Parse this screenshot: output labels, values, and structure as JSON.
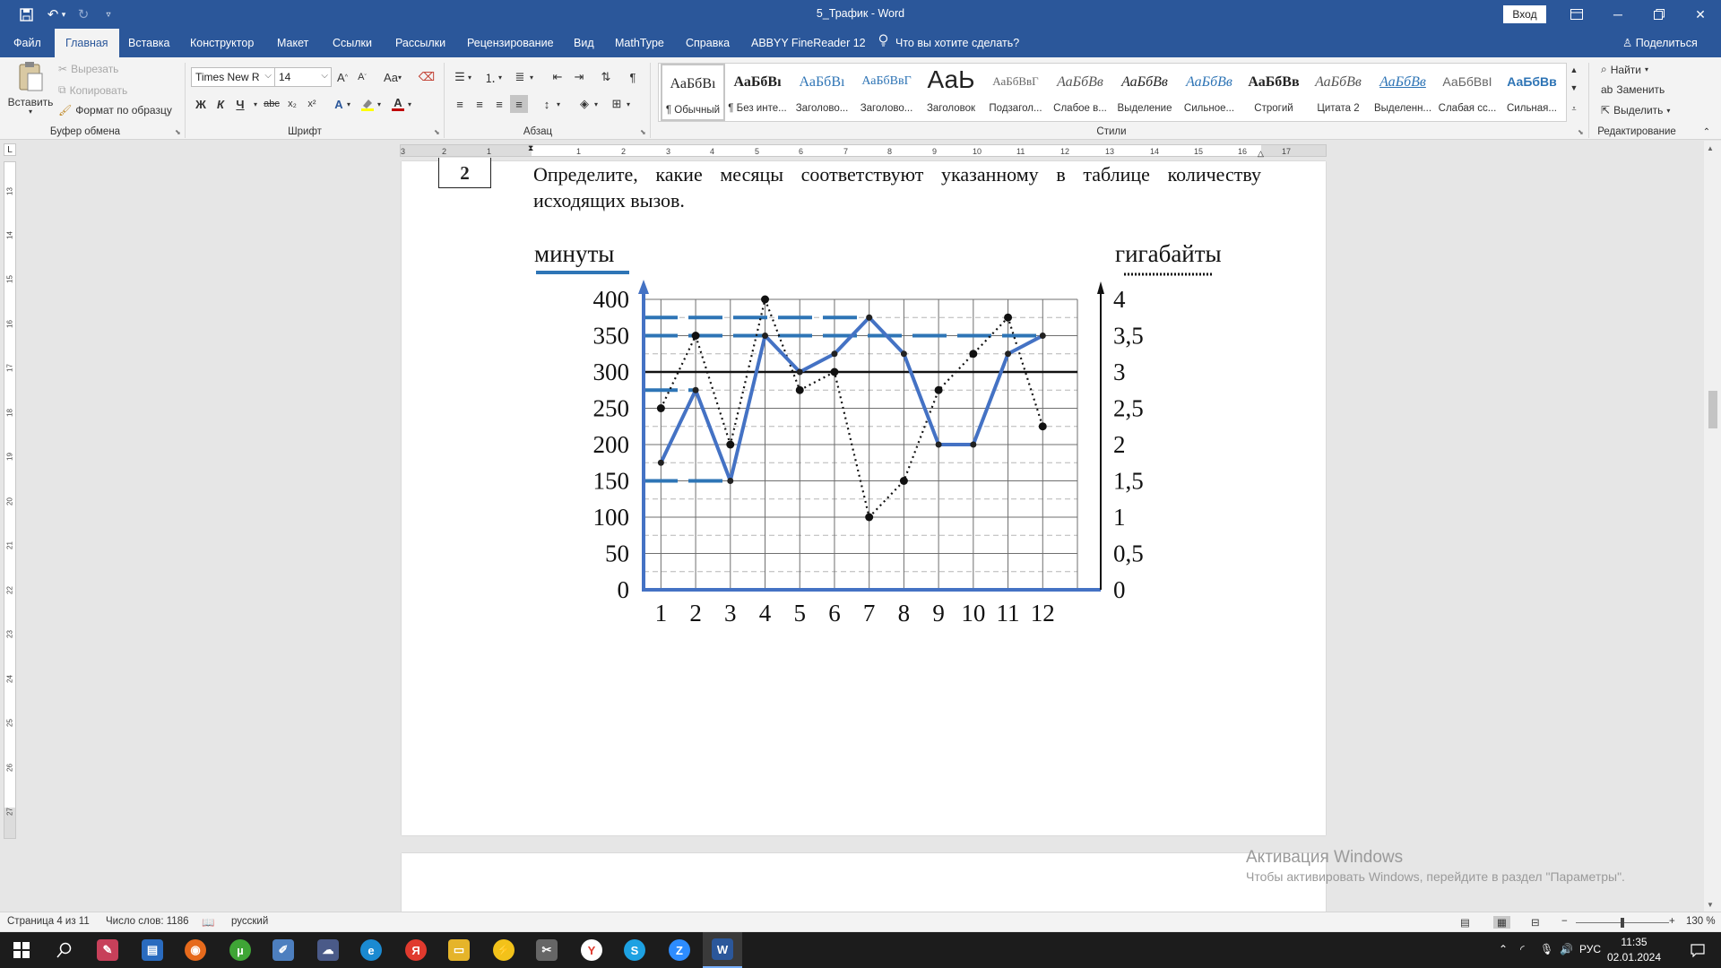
{
  "title_bar": {
    "document_title": "5_Трафик  -  Word",
    "signin_label": "Вход"
  },
  "tabs": [
    "Файл",
    "Главная",
    "Вставка",
    "Конструктор",
    "Макет",
    "Ссылки",
    "Рассылки",
    "Рецензирование",
    "Вид",
    "MathType",
    "Справка",
    "ABBYY FineReader 12"
  ],
  "tell_me": "Что вы хотите сделать?",
  "share_label": "Поделиться",
  "clipboard": {
    "paste": "Вставить",
    "cut": "Вырезать",
    "copy": "Копировать",
    "format_painter": "Формат по образцу",
    "group": "Буфер обмена"
  },
  "font": {
    "name": "Times New R",
    "size": "14",
    "group": "Шрифт",
    "bold": "Ж",
    "italic": "К",
    "underline": "Ч",
    "strike": "abc",
    "sub": "x₂",
    "sup": "x²",
    "case": "Aa",
    "grow": "A",
    "shrink": "A"
  },
  "paragraph": {
    "group": "Абзац"
  },
  "styles": {
    "group": "Стили",
    "items": [
      {
        "preview": "АаБбВı",
        "name": "¶ Обычный"
      },
      {
        "preview": "АаБбВı",
        "name": "¶ Без инте..."
      },
      {
        "preview": "АаБбВı",
        "name": "Заголово..."
      },
      {
        "preview": "АаБбВвГ",
        "name": "Заголово..."
      },
      {
        "preview": "АаЬ",
        "name": "Заголовок"
      },
      {
        "preview": "АаБбВвГ",
        "name": "Подзагол..."
      },
      {
        "preview": "АаБбВв",
        "name": "Слабое в..."
      },
      {
        "preview": "АаБбВв",
        "name": "Выделение"
      },
      {
        "preview": "АаБбВв",
        "name": "Сильное..."
      },
      {
        "preview": "АаБбВв",
        "name": "Строгий"
      },
      {
        "preview": "АаБбВв",
        "name": "Цитата 2"
      },
      {
        "preview": "АаБбВв",
        "name": "Выделенн..."
      },
      {
        "preview": "АаБбВвI",
        "name": "Слабая сс..."
      },
      {
        "preview": "АаБбВв",
        "name": "Сильная..."
      }
    ]
  },
  "editing": {
    "group": "Редактирование",
    "find": "Найти",
    "replace": "Заменить",
    "select": "Выделить"
  },
  "ruler_marks": [
    "3",
    "2",
    "1",
    "1",
    "2",
    "3",
    "4",
    "5",
    "6",
    "7",
    "8",
    "9",
    "10",
    "11",
    "12",
    "13",
    "14",
    "15",
    "16",
    "17"
  ],
  "vruler_marks": [
    "13",
    "14",
    "15",
    "16",
    "17",
    "18",
    "19",
    "20",
    "21",
    "22",
    "23",
    "24",
    "25",
    "26",
    "27"
  ],
  "document": {
    "question_number": "2",
    "question_text": "Определите, какие месяцы соответствуют указанному в таблице количеству исходящих вызов."
  },
  "chart_data": {
    "type": "line",
    "left_axis_title": "минуты",
    "right_axis_title": "гигабайты",
    "categories": [
      "1",
      "2",
      "3",
      "4",
      "5",
      "6",
      "7",
      "8",
      "9",
      "10",
      "11",
      "12"
    ],
    "ylim": [
      0,
      400
    ],
    "y2lim": [
      0,
      4
    ],
    "left_ticks": [
      "0",
      "50",
      "100",
      "150",
      "200",
      "250",
      "300",
      "350",
      "400"
    ],
    "right_ticks": [
      "0",
      "0,5",
      "1",
      "1,5",
      "2",
      "2,5",
      "3",
      "3,5",
      "4"
    ],
    "series": [
      {
        "axis": "left",
        "style": "solid",
        "values": [
          175,
          275,
          150,
          350,
          300,
          325,
          375,
          325,
          200,
          200,
          325,
          350
        ]
      },
      {
        "axis": "right",
        "style": "dotted",
        "values": [
          2.5,
          3.5,
          2,
          4,
          2.75,
          3,
          1,
          1.5,
          2.75,
          3.25,
          3.75,
          2.25
        ]
      }
    ],
    "highlighted_levels_minutes": [
      375,
      350,
      275,
      150
    ],
    "reference_level_minutes": 300,
    "grid": true,
    "colors": {
      "minutes": "#4472c4",
      "highlight": "#2e75b6",
      "gigabytes": "#111111"
    }
  },
  "watermark": {
    "title": "Активация Windows",
    "subtitle": "Чтобы активировать Windows, перейдите в раздел \"Параметры\"."
  },
  "status": {
    "page": "Страница 4 из 11",
    "words": "Число слов: 1186",
    "language": "русский",
    "zoom": "130 %"
  },
  "taskbar": {
    "lang": "РУС",
    "time": "11:35",
    "date": "02.01.2024"
  },
  "colors": {
    "word_blue": "#2b579a"
  }
}
